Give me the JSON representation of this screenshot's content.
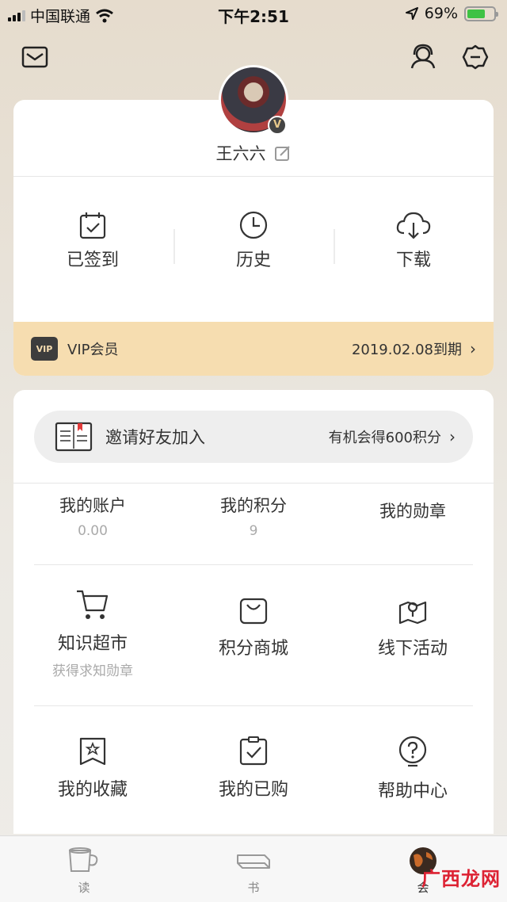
{
  "status_bar": {
    "carrier": "中国联通",
    "time": "下午2:51",
    "battery": "69%",
    "battery_level": 0.69
  },
  "profile": {
    "username": "王六六",
    "avatar_badge": "V"
  },
  "quick_actions": [
    {
      "label": "已签到",
      "icon": "calendar-check-icon"
    },
    {
      "label": "历史",
      "icon": "clock-icon"
    },
    {
      "label": "下载",
      "icon": "cloud-download-icon"
    }
  ],
  "vip": {
    "badge": "VIP",
    "label": "VIP会员",
    "expire": "2019.02.08到期"
  },
  "invite": {
    "title": "邀请好友加入",
    "subtitle": "有机会得600积分"
  },
  "stats": [
    {
      "title": "我的账户",
      "value": "0.00"
    },
    {
      "title": "我的积分",
      "value": "9"
    },
    {
      "title": "我的勋章",
      "value": ""
    }
  ],
  "grid_row1": [
    {
      "title": "知识超市",
      "subtitle": "获得求知勋章",
      "icon": "cart-icon"
    },
    {
      "title": "积分商城",
      "subtitle": "",
      "icon": "shopping-bag-icon"
    },
    {
      "title": "线下活动",
      "subtitle": "",
      "icon": "map-pin-icon"
    }
  ],
  "grid_row2": [
    {
      "title": "我的收藏",
      "icon": "bookmark-star-icon"
    },
    {
      "title": "我的已购",
      "icon": "purchased-clipboard-icon"
    },
    {
      "title": "帮助中心",
      "icon": "help-bulb-icon"
    }
  ],
  "tabs": [
    {
      "label": "读",
      "icon": "cup-icon"
    },
    {
      "label": "书",
      "icon": "book-icon"
    },
    {
      "label": "会",
      "icon": "globe-avatar-icon"
    }
  ],
  "watermark": "广西龙网"
}
